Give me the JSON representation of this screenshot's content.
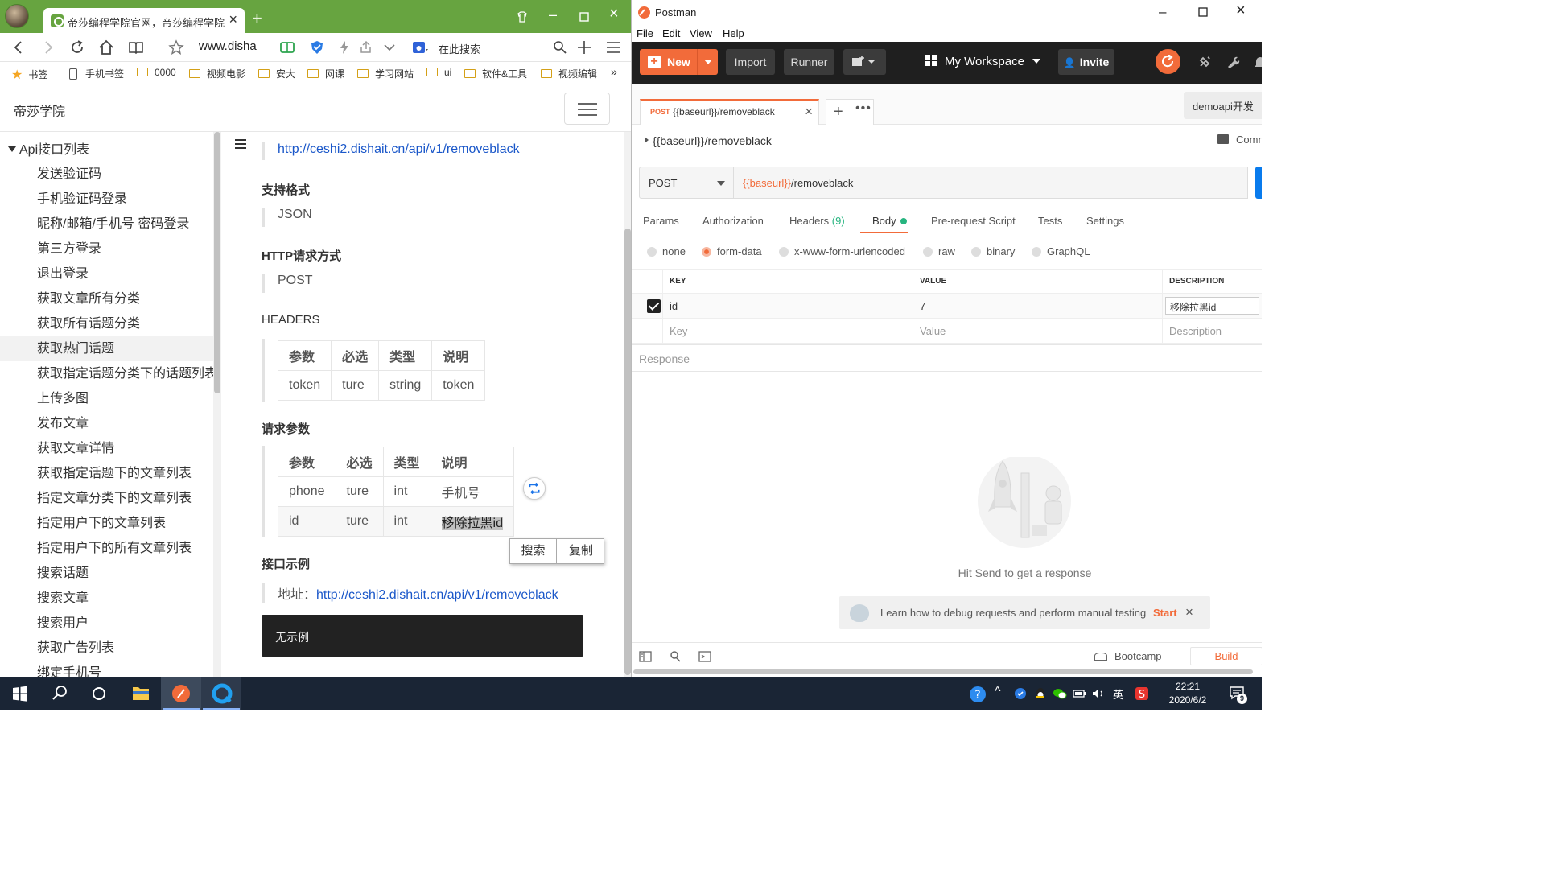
{
  "browser": {
    "tab_title": "帝莎编程学院官网，帝莎编程学院专",
    "url": "www.disha",
    "search_placeholder": "在此搜索",
    "bookmarks": [
      "书签",
      "手机书签",
      "0000",
      "视频电影",
      "安大",
      "网课",
      "学习网站",
      "ui",
      "软件&工具",
      "视频编辑"
    ],
    "bookmarks_more": "»"
  },
  "site": {
    "title": "帝莎学院",
    "sidebar_heading": "Api接口列表",
    "sidebar_items": [
      "发送验证码",
      "手机验证码登录",
      "昵称/邮箱/手机号 密码登录",
      "第三方登录",
      "退出登录",
      "获取文章所有分类",
      "获取所有话题分类",
      "获取热门话题",
      "获取指定话题分类下的话题列表",
      "上传多图",
      "发布文章",
      "获取文章详情",
      "获取指定话题下的文章列表",
      "指定文章分类下的文章列表",
      "指定用户下的文章列表",
      "指定用户下的所有文章列表",
      "搜索话题",
      "搜索文章",
      "搜索用户",
      "获取广告列表",
      "绑定手机号"
    ],
    "active_item": "获取热门话题"
  },
  "doc": {
    "api_url": "http://ceshi2.dishait.cn/api/v1/removeblack",
    "format_heading": "支持格式",
    "format_value": "JSON",
    "method_heading": "HTTP请求方式",
    "method_value": "POST",
    "headers_heading": "HEADERS",
    "headers_table": {
      "columns": [
        "参数",
        "必选",
        "类型",
        "说明"
      ],
      "rows": [
        [
          "token",
          "ture",
          "string",
          "token"
        ]
      ]
    },
    "params_heading": "请求参数",
    "params_table": {
      "columns": [
        "参数",
        "必选",
        "类型",
        "说明"
      ],
      "rows": [
        [
          "phone",
          "ture",
          "int",
          "手机号"
        ],
        [
          "id",
          "ture",
          "int",
          "移除拉黑id"
        ]
      ]
    },
    "popup_search": "搜索",
    "popup_copy": "复制",
    "example_heading": "接口示例",
    "example_addr_label": "地址：",
    "example_addr": "http://ceshi2.dishait.cn/api/v1/removeblack",
    "example_box": "无示例"
  },
  "postman": {
    "window_title": "Postman",
    "menu": [
      "File",
      "Edit",
      "View",
      "Help"
    ],
    "new_label": "New",
    "import_label": "Import",
    "runner_label": "Runner",
    "workspace_label": "My Workspace",
    "invite_label": "Invite",
    "tab_method": "POST",
    "tab_name": "{{baseurl}}/removeblack",
    "env_label": "demoapi开发",
    "request_name": "{{baseurl}}/removeblack",
    "comments_label": "Comm",
    "method": "POST",
    "url_var": "{{baseurl}}",
    "url_path": "/removeblack",
    "request_tabs": [
      "Params",
      "Authorization",
      "Headers",
      "Body",
      "Pre-request Script",
      "Tests",
      "Settings"
    ],
    "headers_count": "(9)",
    "body_types": [
      "none",
      "form-data",
      "x-www-form-urlencoded",
      "raw",
      "binary",
      "GraphQL"
    ],
    "selected_body_type": "form-data",
    "kv_columns": [
      "KEY",
      "VALUE",
      "DESCRIPTION"
    ],
    "kv_rows": [
      {
        "key": "id",
        "value": "7",
        "description": "移除拉黑id",
        "checked": true
      }
    ],
    "kv_placeholders": {
      "key": "Key",
      "value": "Value",
      "description": "Description"
    },
    "response_label": "Response",
    "hit_send": "Hit Send to get a response",
    "hint_text": "Learn how to debug requests and perform manual testing",
    "hint_start": "Start",
    "bootcamp_label": "Bootcamp",
    "build_label": "Build",
    "colors": {
      "accent": "#f26b3a",
      "header_bg": "#1f1f1f",
      "send_blue": "#097bed"
    }
  },
  "taskbar": {
    "time": "22:21",
    "date": "2020/6/2",
    "ime": "英",
    "notifications": "9"
  }
}
